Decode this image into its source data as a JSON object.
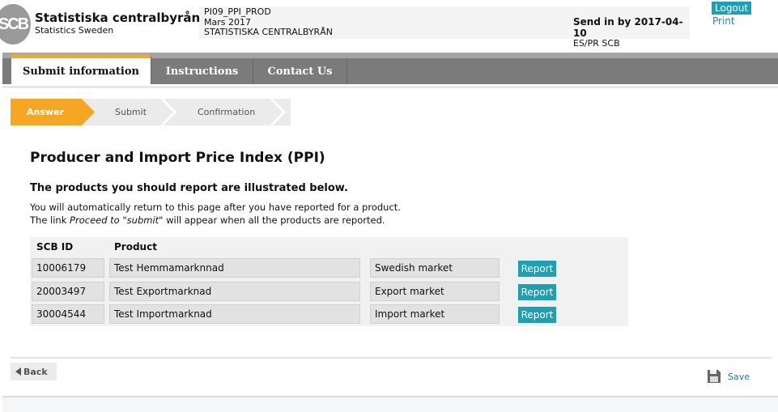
{
  "brand": {
    "logo_text": "SCB",
    "title": "Statistiska centralbyrån",
    "subtitle": "Statistics Sweden"
  },
  "info": {
    "survey": "PI09_PPI_PROD",
    "period": "Mars 2017",
    "org": "STATISTISKA CENTRALBYRÅN",
    "deadline": "Send in by 2017-04-10",
    "unit": "ES/PR SCB"
  },
  "top_links": {
    "logout": "Logout",
    "print": "Print"
  },
  "nav": {
    "tabs": [
      {
        "label": "Submit information",
        "active": true
      },
      {
        "label": "Instructions"
      },
      {
        "label": "Contact Us"
      }
    ]
  },
  "steps": [
    {
      "label": "Answer",
      "active": true
    },
    {
      "label": "Submit"
    },
    {
      "label": "Confirmation"
    }
  ],
  "main": {
    "title": "Producer and Import Price Index (PPI)",
    "subtitle": "The products you should report are illustrated below.",
    "line1": "You will automatically return to this page after you have reported for a product.",
    "line2_pre": "The link ",
    "line2_em": "Proceed to \"submit\"",
    "line2_post": " will appear when all the products are reported."
  },
  "table": {
    "headers": [
      "SCB ID",
      "Product"
    ],
    "rows": [
      {
        "id": "10006179",
        "product": "Test Hemmamarknnad",
        "market": "Swedish market",
        "action": "Report"
      },
      {
        "id": "20003497",
        "product": "Test Exportmarknad",
        "market": "Export market",
        "action": "Report"
      },
      {
        "id": "30004544",
        "product": "Test Importmarknad",
        "market": "Import market",
        "action": "Report"
      }
    ]
  },
  "footer": {
    "back": "Back",
    "save": "Save"
  },
  "colors": {
    "accent": "#f5a623",
    "teal": "#1f9fb3",
    "nav": "#7b7b7b"
  }
}
